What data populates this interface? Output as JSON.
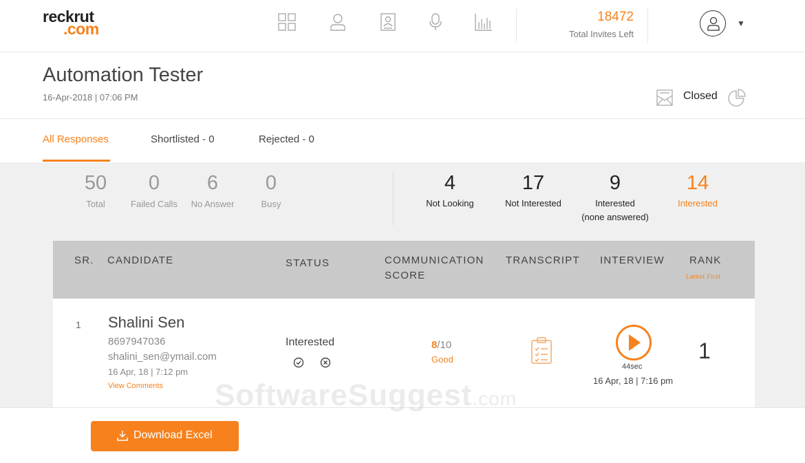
{
  "brand": {
    "logo_line1": "reckrut",
    "logo_line2": ".com"
  },
  "header": {
    "nav_icons": [
      "dashboard-icon",
      "user-icon",
      "profile-card-icon",
      "microphone-icon",
      "analytics-icon"
    ],
    "invites_count": "18472",
    "invites_label": "Total Invites Left"
  },
  "job": {
    "title": "Automation Tester",
    "datetime": "16-Apr-2018 | 07:06 PM",
    "status": "Closed"
  },
  "tabs": [
    {
      "label": "All Responses",
      "active": true
    },
    {
      "label": "Shortlisted - 0",
      "active": false
    },
    {
      "label": "Rejected - 0",
      "active": false
    }
  ],
  "stats_left": [
    {
      "value": "50",
      "label": "Total"
    },
    {
      "value": "0",
      "label": "Failed Calls"
    },
    {
      "value": "6",
      "label": "No Answer"
    },
    {
      "value": "0",
      "label": "Busy"
    }
  ],
  "stats_right": [
    {
      "value": "4",
      "label": "Not Looking",
      "sub": ""
    },
    {
      "value": "17",
      "label": "Not Interested",
      "sub": ""
    },
    {
      "value": "9",
      "label": "Interested",
      "sub": "(none answered)"
    },
    {
      "value": "14",
      "label": "Interested",
      "sub": ""
    }
  ],
  "table": {
    "columns": [
      "SR.",
      "CANDIDATE",
      "STATUS",
      "COMMUNICATION",
      "SCORE",
      "TRANSCRIPT",
      "INTERVIEW",
      "RANK"
    ],
    "rank_sort": "Latest First",
    "rows": [
      {
        "sr": "1",
        "name": "Shalini Sen",
        "phone": "8697947036",
        "email": "shalini_sen@ymail.com",
        "date": "16 Apr, 18 | 7:12 pm",
        "comments_link": "View Comments",
        "status": "Interested",
        "score": "8",
        "score_max": "/10",
        "score_label": "Good",
        "interview_duration": "44sec",
        "interview_date": "16 Apr, 18 | 7:16 pm",
        "rank": "1"
      }
    ]
  },
  "footer": {
    "download_label": "Download Excel"
  },
  "watermark": {
    "main": "SoftwareSuggest",
    "suffix": ".com"
  },
  "colors": {
    "accent": "#f7811c",
    "header_bg": "#c9c9c9",
    "panel_bg": "#f0f0f0"
  }
}
